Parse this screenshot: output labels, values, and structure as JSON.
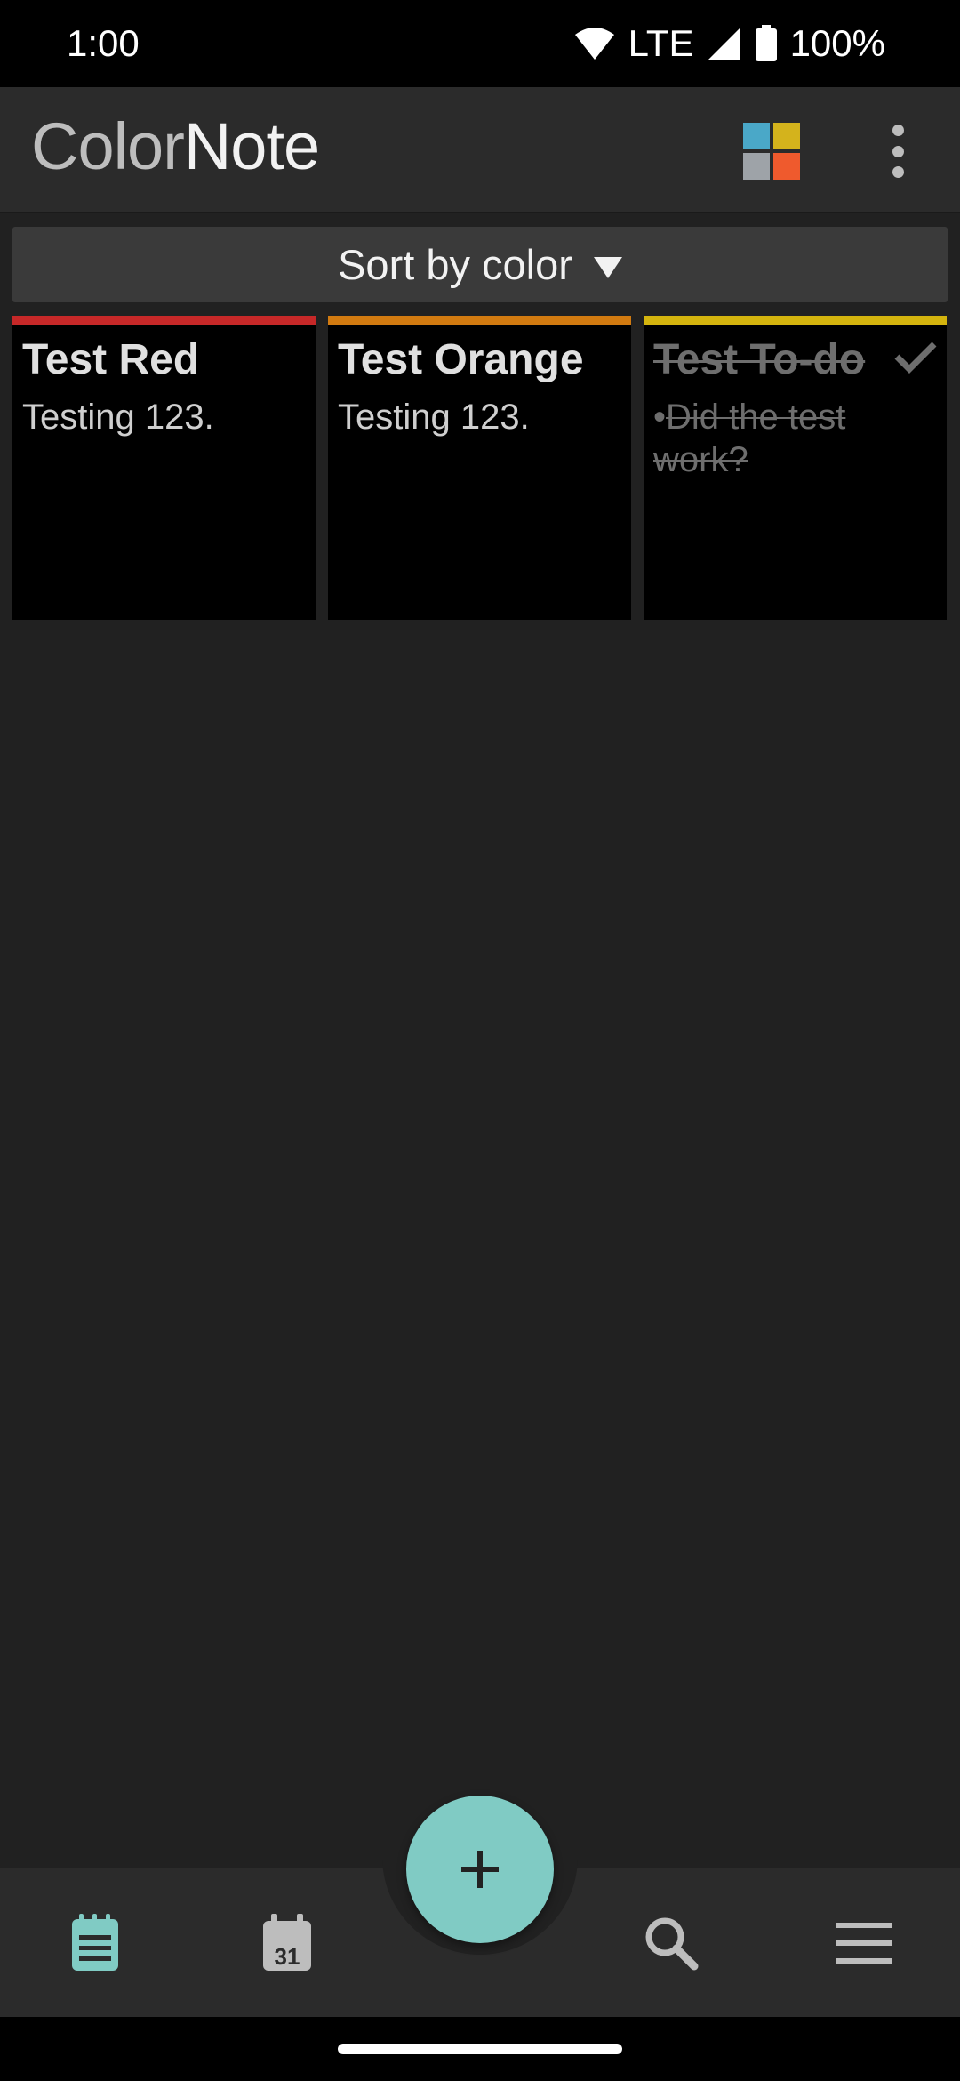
{
  "status_bar": {
    "time": "1:00",
    "network": "LTE",
    "battery": "100%"
  },
  "app_bar": {
    "logo_color": "Color",
    "logo_note": "Note",
    "color_filter_swatches": [
      "#4aa8c8",
      "#d4b31c",
      "#9ea3a8",
      "#ef5a2d"
    ],
    "overflow_icon": "more-vert-icon"
  },
  "sort": {
    "label": "Sort by color"
  },
  "notes": [
    {
      "title": "Test Red",
      "body": "Testing 123.",
      "color": "#c62828",
      "done": false
    },
    {
      "title": "Test Orange",
      "body": "Testing 123.",
      "color": "#d17a10",
      "done": false
    },
    {
      "title": "Test To-do",
      "body_bullet": "•",
      "body": "Did the test work?",
      "color": "#d4b40e",
      "done": true
    }
  ],
  "bottom_nav": {
    "items": [
      {
        "icon": "notes-icon",
        "active": true
      },
      {
        "icon": "calendar-icon",
        "label": "31",
        "active": false
      },
      {
        "icon": "add-icon",
        "label": "+"
      },
      {
        "icon": "search-icon",
        "active": false
      },
      {
        "icon": "menu-icon",
        "active": false
      }
    ],
    "accent": "#80cbc4"
  }
}
